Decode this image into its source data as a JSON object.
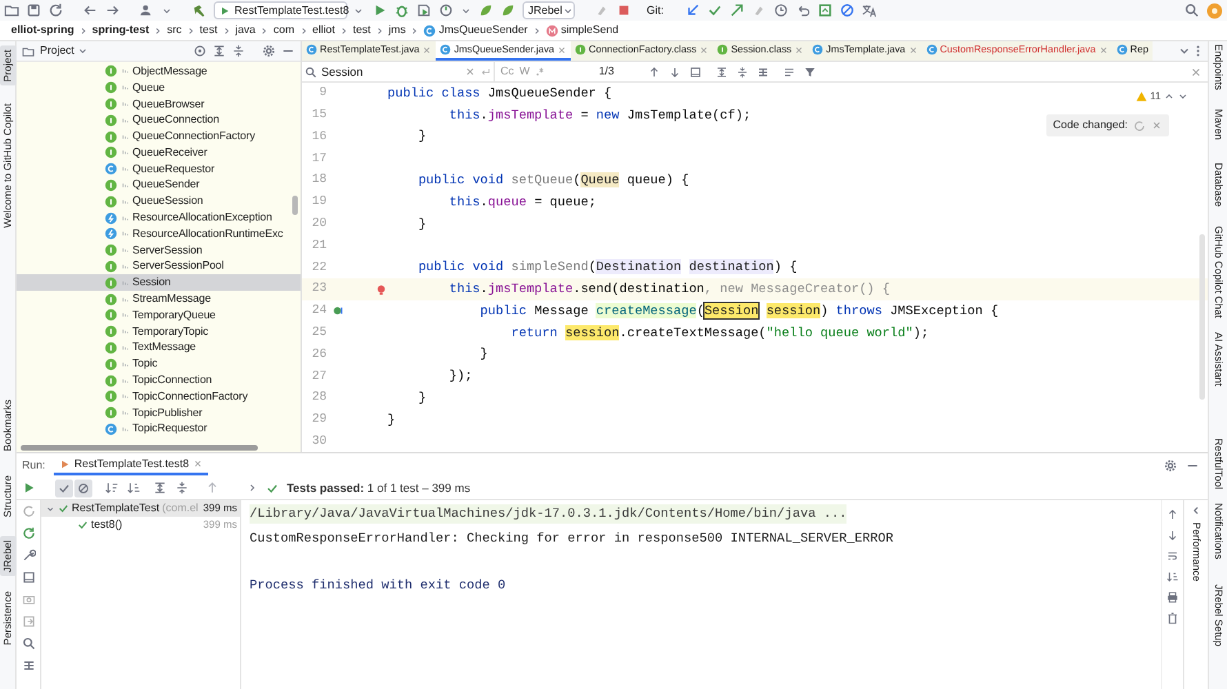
{
  "toolbar": {
    "run_config": "RestTemplateTest.test8",
    "plugin": "JRebel",
    "vcs_label": "Git:"
  },
  "breadcrumbs": [
    {
      "label": "elliot-spring",
      "kind": "module"
    },
    {
      "label": "spring-test",
      "kind": "module"
    },
    {
      "label": "src",
      "kind": "dir"
    },
    {
      "label": "test",
      "kind": "dir"
    },
    {
      "label": "java",
      "kind": "dir"
    },
    {
      "label": "com",
      "kind": "dir"
    },
    {
      "label": "elliot",
      "kind": "dir"
    },
    {
      "label": "test",
      "kind": "dir"
    },
    {
      "label": "jms",
      "kind": "dir"
    },
    {
      "label": "JmsQueueSender",
      "kind": "class"
    },
    {
      "label": "simpleSend",
      "kind": "method"
    }
  ],
  "left_stripe": [
    {
      "label": "Project",
      "selected": true
    },
    {
      "label": "Welcome to GitHub Copilot",
      "selected": false
    },
    {
      "label": "Bookmarks",
      "selected": false
    },
    {
      "label": "Structure",
      "selected": false
    },
    {
      "label": "JRebel",
      "selected": true
    },
    {
      "label": "Persistence",
      "selected": false
    }
  ],
  "project": {
    "title": "Project",
    "items": [
      {
        "name": "ObjectMessage",
        "kind": "interface",
        "selected": false
      },
      {
        "name": "Queue",
        "kind": "interface",
        "selected": false
      },
      {
        "name": "QueueBrowser",
        "kind": "interface",
        "selected": false
      },
      {
        "name": "QueueConnection",
        "kind": "interface",
        "selected": false
      },
      {
        "name": "QueueConnectionFactory",
        "kind": "interface",
        "selected": false
      },
      {
        "name": "QueueReceiver",
        "kind": "interface",
        "selected": false
      },
      {
        "name": "QueueRequestor",
        "kind": "class",
        "selected": false
      },
      {
        "name": "QueueSender",
        "kind": "interface",
        "selected": false
      },
      {
        "name": "QueueSession",
        "kind": "interface",
        "selected": false
      },
      {
        "name": "ResourceAllocationException",
        "kind": "exception",
        "selected": false
      },
      {
        "name": "ResourceAllocationRuntimeExc",
        "kind": "exception",
        "selected": false
      },
      {
        "name": "ServerSession",
        "kind": "interface",
        "selected": false
      },
      {
        "name": "ServerSessionPool",
        "kind": "interface",
        "selected": false
      },
      {
        "name": "Session",
        "kind": "interface",
        "selected": true
      },
      {
        "name": "StreamMessage",
        "kind": "interface",
        "selected": false
      },
      {
        "name": "TemporaryQueue",
        "kind": "interface",
        "selected": false
      },
      {
        "name": "TemporaryTopic",
        "kind": "interface",
        "selected": false
      },
      {
        "name": "TextMessage",
        "kind": "interface",
        "selected": false
      },
      {
        "name": "Topic",
        "kind": "interface",
        "selected": false
      },
      {
        "name": "TopicConnection",
        "kind": "interface",
        "selected": false
      },
      {
        "name": "TopicConnectionFactory",
        "kind": "interface",
        "selected": false
      },
      {
        "name": "TopicPublisher",
        "kind": "interface",
        "selected": false
      },
      {
        "name": "TopicRequestor",
        "kind": "class",
        "selected": false
      }
    ]
  },
  "editor": {
    "tabs": [
      {
        "label": "RestTemplateTest.java",
        "kind": "class",
        "selected": false,
        "error": false
      },
      {
        "label": "JmsQueueSender.java",
        "kind": "class",
        "selected": true,
        "error": false
      },
      {
        "label": "ConnectionFactory.class",
        "kind": "interface",
        "selected": false,
        "error": false
      },
      {
        "label": "Session.class",
        "kind": "interface",
        "selected": false,
        "error": false
      },
      {
        "label": "JmsTemplate.java",
        "kind": "class",
        "selected": false,
        "error": false
      },
      {
        "label": "CustomResponseErrorHandler.java",
        "kind": "class",
        "selected": false,
        "error": true
      },
      {
        "label": "Rep",
        "kind": "class",
        "selected": false,
        "error": false
      }
    ],
    "search": {
      "value": "Session",
      "match_case": "Cc",
      "words": "W",
      "count": "1/3"
    },
    "warnings": "11",
    "popup": "Code changed:",
    "lines": [
      {
        "no": "9",
        "current": false,
        "segs": [
          {
            "kind": "kw",
            "text": "public class "
          },
          {
            "kind": "plain",
            "text": "JmsQueueSender {"
          }
        ]
      },
      {
        "no": "15",
        "current": false,
        "segs": [
          {
            "kind": "kw",
            "text": "        this"
          },
          {
            "kind": "plain",
            "text": "."
          },
          {
            "kind": "field",
            "text": "jmsTemplate"
          },
          {
            "kind": "plain",
            "text": " = "
          },
          {
            "kind": "kw",
            "text": "new"
          },
          {
            "kind": "plain",
            "text": " JmsTemplate(cf);"
          }
        ]
      },
      {
        "no": "16",
        "current": false,
        "segs": [
          {
            "kind": "plain",
            "text": "    }"
          }
        ]
      },
      {
        "no": "17",
        "current": false
      },
      {
        "no": "18",
        "current": false,
        "segs": [
          {
            "kind": "kw",
            "text": "    public void "
          },
          {
            "kind": "unused",
            "text": "setQueue"
          },
          {
            "kind": "plain",
            "text": "("
          },
          {
            "kind": "occur",
            "text": "Queue"
          },
          {
            "kind": "plain",
            "text": " queue) {"
          }
        ]
      },
      {
        "no": "19",
        "current": false,
        "segs": [
          {
            "kind": "kw",
            "text": "        this"
          },
          {
            "kind": "plain",
            "text": "."
          },
          {
            "kind": "field",
            "text": "queue"
          },
          {
            "kind": "plain",
            "text": " = queue;"
          }
        ]
      },
      {
        "no": "20",
        "current": false,
        "segs": [
          {
            "kind": "plain",
            "text": "    }"
          }
        ]
      },
      {
        "no": "21",
        "current": false
      },
      {
        "no": "22",
        "current": false,
        "segs": [
          {
            "kind": "kw",
            "text": "    public void "
          },
          {
            "kind": "unused",
            "text": "simpleSend"
          },
          {
            "kind": "plain",
            "text": "("
          },
          {
            "kind": "param",
            "text": "Destination"
          },
          {
            "kind": "param",
            "text": " destination"
          },
          {
            "kind": "plain",
            "text": ") {"
          }
        ]
      },
      {
        "no": "23",
        "current": true,
        "kind": "bulb",
        "segs": [
          {
            "kind": "kw",
            "text": "        this"
          },
          {
            "kind": "plain",
            "text": "."
          },
          {
            "kind": "field",
            "text": "jmsTemplate"
          },
          {
            "kind": "plain",
            "text": ".send(destination"
          },
          {
            "kind": "muted",
            "text": ", new MessageCreator() {"
          }
        ]
      },
      {
        "no": "24",
        "current": false,
        "kind": "implements",
        "segs": [
          {
            "kind": "kw",
            "text": "            public "
          },
          {
            "kind": "plain",
            "text": "Message "
          },
          {
            "kind": "method",
            "text": "createMessage"
          },
          {
            "kind": "plain",
            "text": "("
          },
          {
            "kind": "match_current",
            "text": "Session"
          },
          {
            "kind": "match",
            "text": " session"
          },
          {
            "kind": "plain",
            "text": ") "
          },
          {
            "kind": "kw",
            "text": "throws "
          },
          {
            "kind": "plain",
            "text": "JMSException {"
          }
        ]
      },
      {
        "no": "25",
        "current": false,
        "segs": [
          {
            "kind": "kw",
            "text": "                return "
          },
          {
            "kind": "match",
            "text": "session"
          },
          {
            "kind": "plain",
            "text": ".createTextMessage("
          },
          {
            "kind": "str",
            "text": "\"hello queue world\""
          },
          {
            "kind": "plain",
            "text": ");"
          }
        ]
      },
      {
        "no": "26",
        "current": false,
        "segs": [
          {
            "kind": "plain",
            "text": "            }"
          }
        ]
      },
      {
        "no": "27",
        "current": false,
        "segs": [
          {
            "kind": "plain",
            "text": "        });"
          }
        ]
      },
      {
        "no": "28",
        "current": false,
        "segs": [
          {
            "kind": "plain",
            "text": "    }"
          }
        ]
      },
      {
        "no": "29",
        "current": false,
        "segs": [
          {
            "kind": "plain",
            "text": "}"
          }
        ]
      },
      {
        "no": "30",
        "current": false
      }
    ]
  },
  "right_stripe": [
    "Endpoints",
    "Maven",
    "Database",
    "GitHub Copilot Chat",
    "AI Assistant",
    "RestfulTool",
    "Notifications",
    "JRebel Setup"
  ],
  "run": {
    "label": "Run:",
    "tab": "RestTemplateTest.test8",
    "status": "**Tests passed:** 1 of 1 test – 399 ms",
    "tests": [
      {
        "name": "RestTemplateTest",
        "detail": "(com.el",
        "time": "399 ms",
        "passed": true,
        "children": [
          {
            "name": "test8()",
            "time": "399 ms",
            "passed": true
          }
        ]
      }
    ],
    "console": [
      {
        "kind": "command",
        "text": "/Library/Java/JavaVirtualMachines/jdk-17.0.3.1.jdk/Contents/Home/bin/java ..."
      },
      {
        "kind": "output",
        "text": "CustomResponseErrorHandler: Checking for error in response500 INTERNAL_SERVER_ERROR"
      },
      {
        "kind": "exit",
        "text": "Process finished with exit code 0"
      }
    ],
    "side_label": "Performance"
  }
}
